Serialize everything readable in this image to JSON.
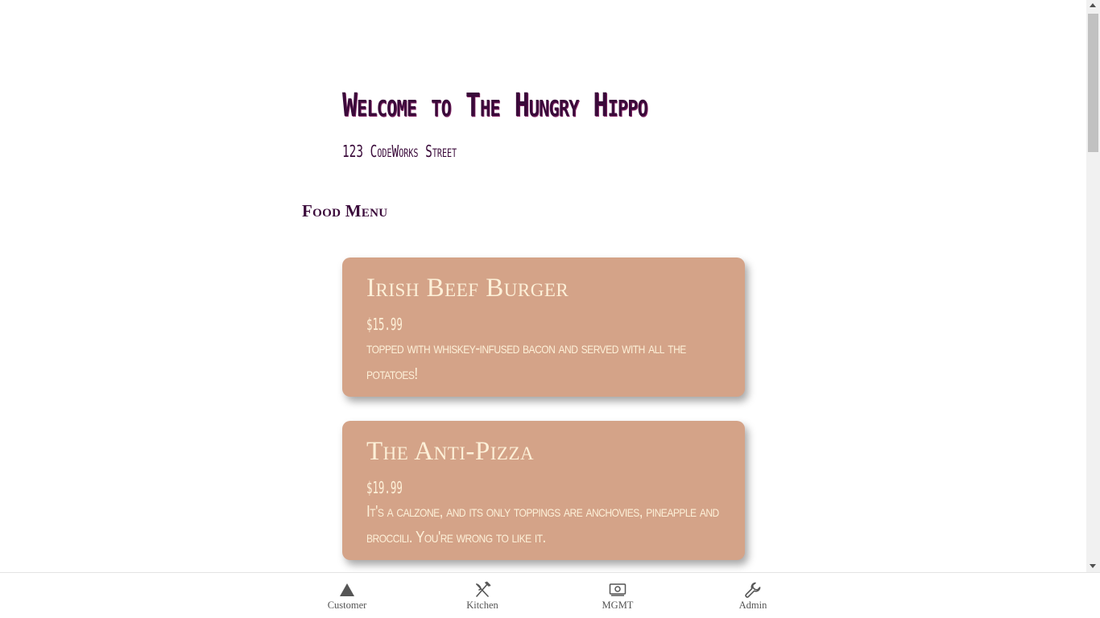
{
  "header": {
    "title": "Welcome to The Hungry Hippo",
    "address": "123 CodeWorks Street"
  },
  "menu": {
    "heading": "Food Menu",
    "items": [
      {
        "name": "Irish Beef Burger",
        "price": "$15.99",
        "description": "topped with whiskey-infused bacon and served with all the potatoes!"
      },
      {
        "name": "The Anti-Pizza",
        "price": "$19.99",
        "description": "It's a calzone, and its only toppings are anchovies, pineapple and broccili. You're wrong to like it."
      }
    ]
  },
  "nav": {
    "items": [
      {
        "label": "Customer",
        "icon": "triangle-icon"
      },
      {
        "label": "Kitchen",
        "icon": "utensils-icon"
      },
      {
        "label": "MGMT",
        "icon": "money-icon"
      },
      {
        "label": "Admin",
        "icon": "wrench-icon"
      }
    ]
  },
  "colors": {
    "card_background": "#d4a388",
    "card_text": "#fdf0d8",
    "heading_text": "#3a0a3a",
    "nav_text": "#555555"
  }
}
